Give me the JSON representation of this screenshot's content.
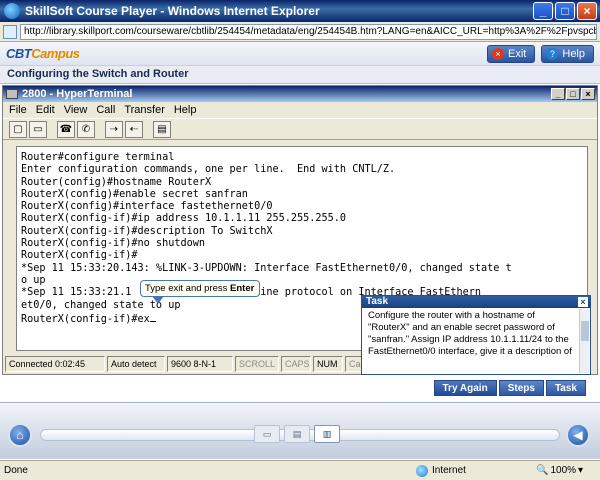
{
  "browser": {
    "title": "SkillSoft Course Player - Windows Internet Explorer",
    "url": "http://library.skillport.com/courseware/cbtlib/254454/metadata/eng/254454B.htm?LANG=en&AICC_URL=http%3A%2F%2Fpvspcbtasp.skillport.com%2F_s",
    "status_text": "Done",
    "zone": "Internet",
    "zoom": "100%"
  },
  "header": {
    "logo_main": "CBT",
    "logo_accent": "Campus",
    "exit_label": "Exit",
    "help_label": "Help"
  },
  "course": {
    "title": "Configuring the Switch and Router"
  },
  "terminal_window": {
    "title": "2800 - HyperTerminal",
    "menu": [
      "File",
      "Edit",
      "View",
      "Call",
      "Transfer",
      "Help"
    ],
    "lines": [
      "Router#configure terminal",
      "Enter configuration commands, one per line.  End with CNTL/Z.",
      "Router(config)#hostname RouterX",
      "RouterX(config)#enable secret sanfran",
      "RouterX(config)#interface fastethernet0/0",
      "RouterX(config-if)#ip address 10.1.1.11 255.255.255.0",
      "RouterX(config-if)#description To SwitchX",
      "RouterX(config-if)#no shutdown",
      "RouterX(config-if)#",
      "*Sep 11 15:33:20.143: %LINK-3-UPDOWN: Interface FastEthernet0/0, changed state t",
      "o up",
      "*Sep 11 15:33:21.1            UPDOWN: Line protocol on Interface FastEthern",
      "et0/0, changed state to up",
      "RouterX(config-if)#ex"
    ],
    "status": {
      "connected": "Connected 0:02:45",
      "detect": "Auto detect",
      "settings": "9600 8-N-1",
      "scroll": "SCROLL",
      "caps": "CAPS",
      "num": "NUM",
      "capture": "Ca"
    }
  },
  "tooltip": {
    "prefix": "Type exit and press ",
    "key": "Enter"
  },
  "task": {
    "title": "Task",
    "text": "Configure the router with a hostname of \"RouterX\" and an enable secret password of \"sanfran.\" Assign IP address 10.1.1.11/24 to the FastEthernet0/0 interface, give it a description of"
  },
  "actions": {
    "try_again": "Try Again",
    "steps": "Steps",
    "task": "Task"
  }
}
